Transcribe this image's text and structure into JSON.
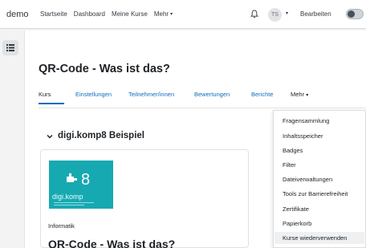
{
  "navbar": {
    "brand": "demo",
    "links": [
      "Startseite",
      "Dashboard",
      "Meine Kurse"
    ],
    "more": "Mehr",
    "avatar_initials": "TS",
    "edit_label": "Bearbeiten"
  },
  "page": {
    "title": "QR-Code - Was ist das?"
  },
  "secondary_nav": {
    "items": [
      "Kurs",
      "Einstellungen",
      "Teilnehmer/innen",
      "Bewertungen",
      "Berichte"
    ],
    "more": "Mehr"
  },
  "section": {
    "title": "digi.komp8 Beispiel"
  },
  "course_card": {
    "logo_text": "digi.komp",
    "logo_digit": "8",
    "category": "Informatik",
    "title": "QR-Code - Was ist das?"
  },
  "dropdown": {
    "items": [
      "Fragensammlung",
      "Inhaltsspeicher",
      "Badges",
      "Filter",
      "Dateiverwaltungen",
      "Tools zur Barrierefreiheit",
      "Zertifikate",
      "Papierkorb",
      "Kurse wiederverwenden"
    ]
  }
}
